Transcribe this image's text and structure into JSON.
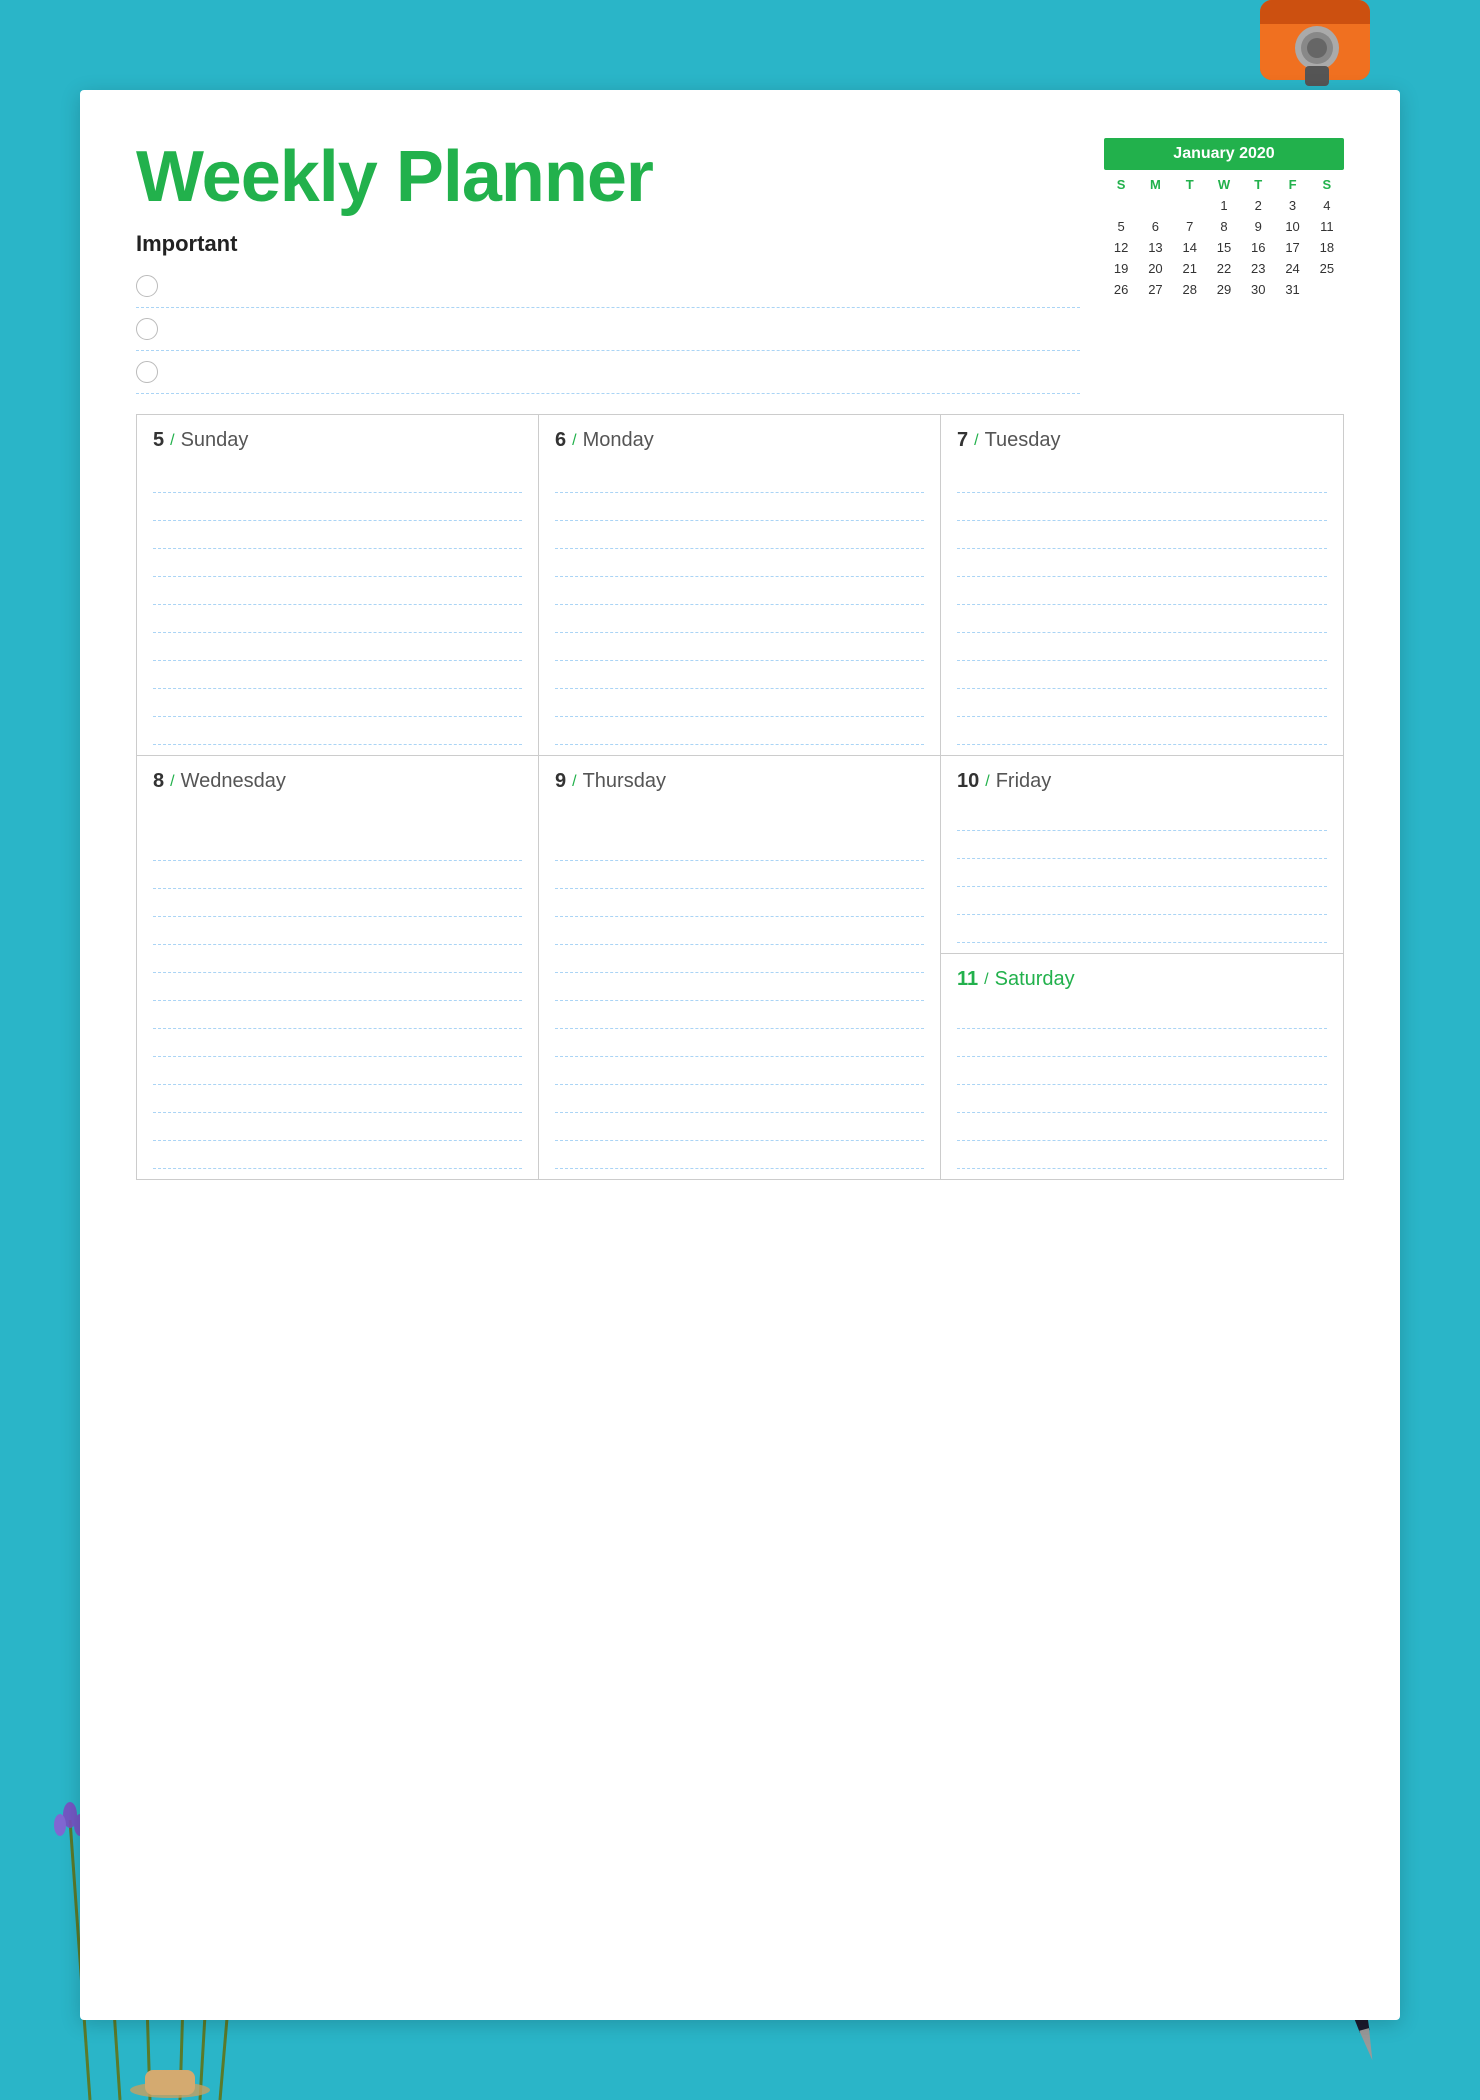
{
  "page": {
    "title": "Weekly Planner",
    "bg_color": "#2ab5c8",
    "accent_color": "#22b14c"
  },
  "header": {
    "title": "Weekly Planner",
    "important_label": "Important",
    "important_items": [
      "",
      "",
      ""
    ]
  },
  "calendar": {
    "month_year": "January 2020",
    "day_headers": [
      "S",
      "M",
      "T",
      "W",
      "T",
      "F",
      "S"
    ],
    "weeks": [
      [
        "",
        "",
        "",
        "1",
        "2",
        "3",
        "4"
      ],
      [
        "5",
        "6",
        "7",
        "8",
        "9",
        "10",
        "11"
      ],
      [
        "12",
        "13",
        "14",
        "15",
        "16",
        "17",
        "18"
      ],
      [
        "19",
        "20",
        "21",
        "22",
        "23",
        "24",
        "25"
      ],
      [
        "26",
        "27",
        "28",
        "29",
        "30",
        "31",
        ""
      ]
    ]
  },
  "days": [
    {
      "num": "5",
      "name": "Sunday",
      "is_saturday": false
    },
    {
      "num": "6",
      "name": "Monday",
      "is_saturday": false
    },
    {
      "num": "7",
      "name": "Tuesday",
      "is_saturday": false
    },
    {
      "num": "8",
      "name": "Wednesday",
      "is_saturday": false
    },
    {
      "num": "9",
      "name": "Thursday",
      "is_saturday": false
    },
    {
      "num": "10",
      "name": "Friday",
      "is_saturday": false
    },
    {
      "num": "11",
      "name": "Saturday",
      "is_saturday": true
    }
  ],
  "lines_per_day": 10
}
